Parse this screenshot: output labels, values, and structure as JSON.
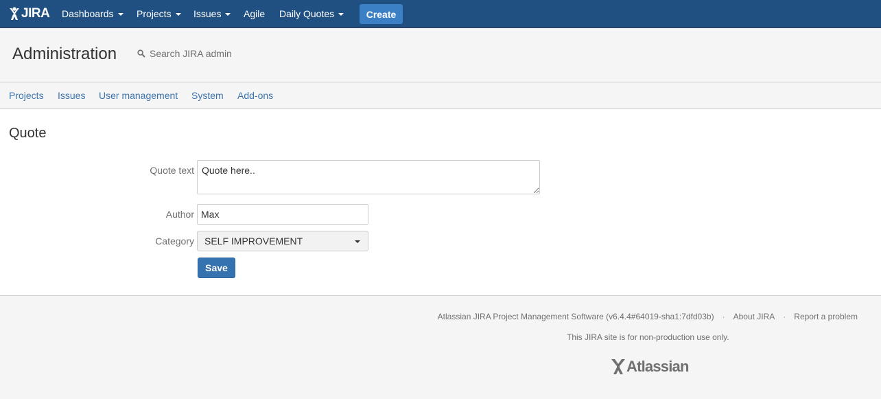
{
  "topbar": {
    "logo_text": "JIRA",
    "nav": [
      {
        "label": "Dashboards",
        "has_dropdown": true
      },
      {
        "label": "Projects",
        "has_dropdown": true
      },
      {
        "label": "Issues",
        "has_dropdown": true
      },
      {
        "label": "Agile",
        "has_dropdown": false
      },
      {
        "label": "Daily Quotes",
        "has_dropdown": true
      }
    ],
    "create_label": "Create",
    "colors": {
      "bar": "#205081",
      "create_button": "#3b7fc4"
    }
  },
  "admin": {
    "title": "Administration",
    "search_placeholder": "Search JIRA admin",
    "tabs": [
      "Projects",
      "Issues",
      "User management",
      "System",
      "Add-ons"
    ]
  },
  "main": {
    "heading": "Quote",
    "form": {
      "quote_label": "Quote text",
      "quote_value": "Quote here..",
      "author_label": "Author",
      "author_value": "Max",
      "category_label": "Category",
      "category_value": "SELF IMPROVEMENT",
      "save_label": "Save"
    }
  },
  "footer": {
    "software": "Atlassian JIRA Project Management Software (v6.4.4#64019-sha1:7dfd03b)",
    "about": "About JIRA",
    "report": "Report a problem",
    "separator": "·",
    "note": "This JIRA site is for non-production use only.",
    "atlassian_logo_text": "Atlassian"
  }
}
